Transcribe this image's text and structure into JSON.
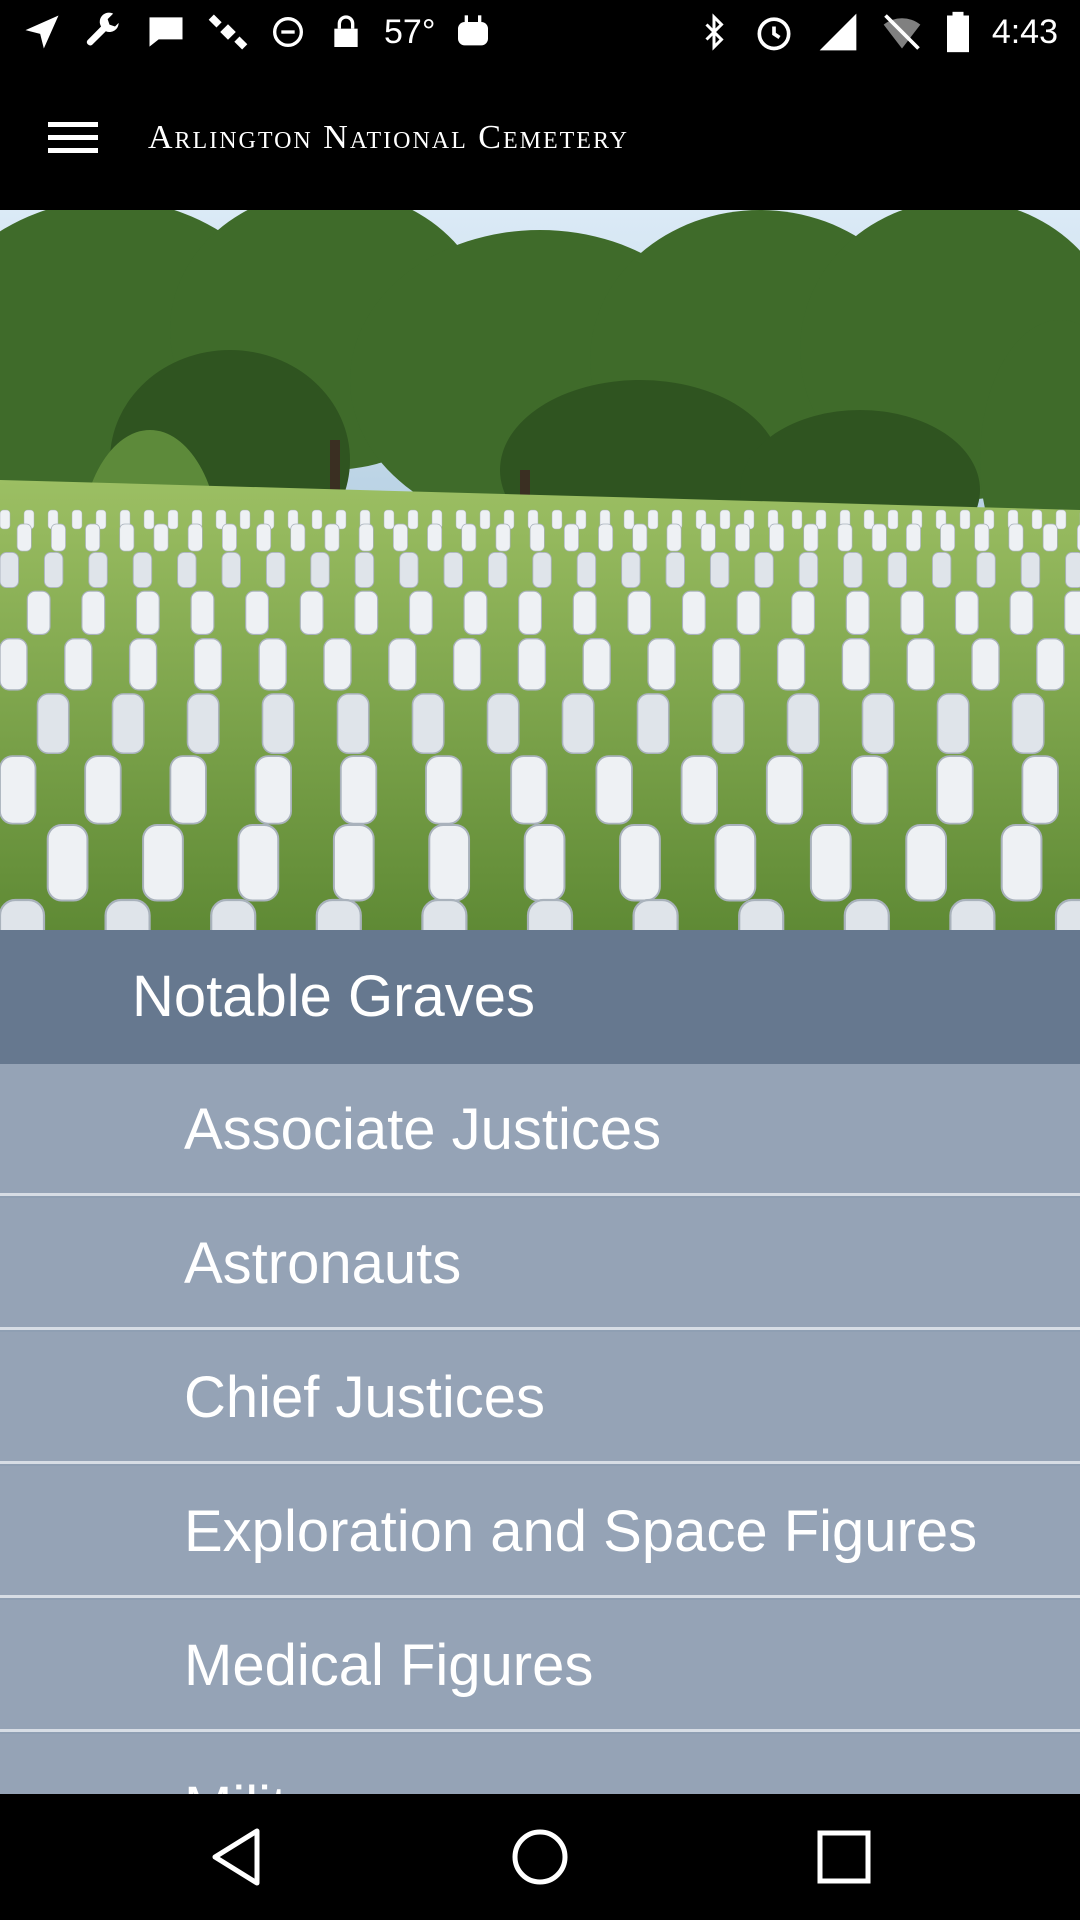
{
  "status_bar": {
    "icons_left": [
      "navigation-arrow-icon",
      "wrench-icon",
      "message-icon",
      "satellite-icon",
      "alarm-off-icon",
      "lock-icon"
    ],
    "temperature": "57°",
    "icons_right": [
      "bluetooth-icon",
      "alarm-icon",
      "cellular-signal-icon",
      "wifi-off-icon",
      "battery-icon"
    ],
    "time": "4:43"
  },
  "app_bar": {
    "menu_icon": "hamburger-menu-icon",
    "title": "Arlington National Cemetery"
  },
  "hero": {
    "colors": {
      "sky": "#cfe3f2",
      "grass": "#7da24a",
      "trees": "#3f6b2a",
      "headstone": "#e8ebef"
    }
  },
  "section": {
    "title": "Notable Graves",
    "color": "#66788f"
  },
  "list": {
    "items": [
      {
        "label": "Associate Justices"
      },
      {
        "label": "Astronauts"
      },
      {
        "label": "Chief Justices"
      },
      {
        "label": "Exploration and Space Figures"
      },
      {
        "label": "Medical Figures"
      },
      {
        "label": "Military"
      }
    ],
    "item_color": "#95a3b6",
    "divider_color": "#d7dde5"
  },
  "nav_bar": {
    "buttons": [
      "back-icon",
      "home-icon",
      "recents-icon"
    ]
  }
}
